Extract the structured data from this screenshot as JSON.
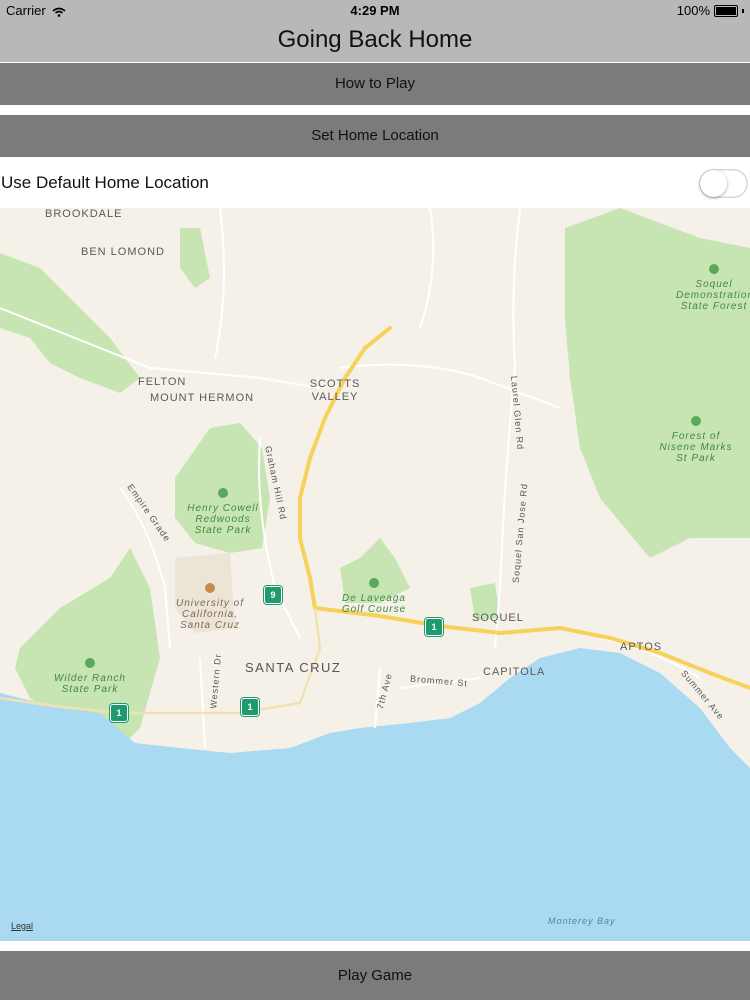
{
  "status_bar": {
    "carrier": "Carrier",
    "time": "4:29 PM",
    "battery": "100%",
    "wifi_icon": "wifi-icon",
    "battery_icon": "battery-icon"
  },
  "nav": {
    "title": "Going Back Home"
  },
  "buttons": {
    "how_to_play": "How to Play",
    "set_home": "Set Home Location",
    "play_game": "Play Game"
  },
  "default_home": {
    "label": "Use Default Home Location",
    "toggle_on": false
  },
  "map": {
    "legal": "Legal",
    "places": {
      "brookdale": "BROOKDALE",
      "ben_lomond": "BEN LOMOND",
      "felton": "FELTON",
      "mount_hermon": "MOUNT HERMON",
      "scotts_valley": "SCOTTS VALLEY",
      "santa_cruz": "SANTA CRUZ",
      "soquel": "SOQUEL",
      "capitola": "CAPITOLA",
      "aptos": "APTOS"
    },
    "parks": {
      "soquel_demo": "Soquel Demonstration State Forest",
      "nisene": "Forest of Nisene Marks St Park",
      "henry_cowell": "Henry Cowell Redwoods State Park",
      "de_laveaga": "De Laveaga Golf Course",
      "ucsc": "University of California, Santa Cruz",
      "wilder": "Wilder Ranch State Park"
    },
    "roads": {
      "graham_hill": "Graham Hill Rd",
      "empire_grade": "Empire Grade",
      "laurel_glen": "Laurel Glen Rd",
      "soquel_san_jose": "Soquel San Jose Rd",
      "western_dr": "Western Dr",
      "seventh_ave": "7th Ave",
      "brommer": "Brommer St",
      "summer_ave": "Summer Ave"
    },
    "water": {
      "monterey_bay": "Monterey Bay"
    },
    "shields": {
      "hwy1": "1",
      "hwy9": "9"
    },
    "colors": {
      "land": "#f5f1e8",
      "park": "#c7e5b2",
      "water": "#aadaf2",
      "highway": "#f7d15a"
    }
  }
}
